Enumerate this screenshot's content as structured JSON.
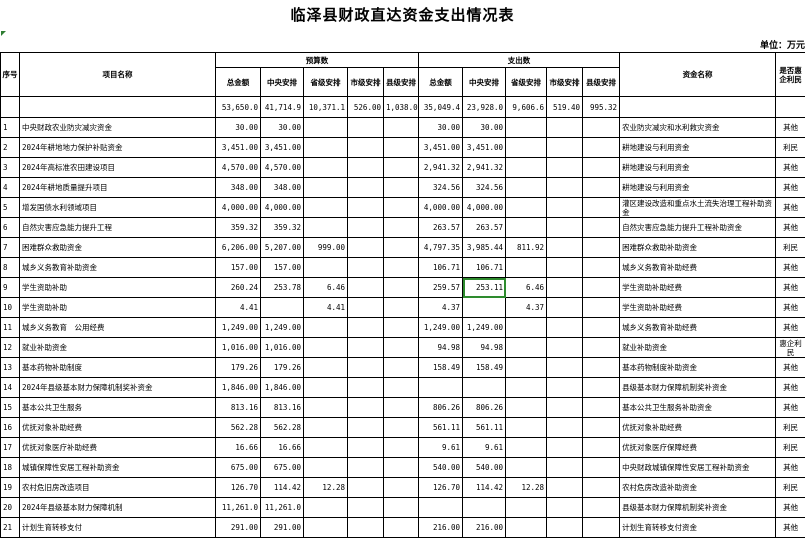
{
  "title": "临泽县财政直达资金支出情况表",
  "unit": "单位：万元",
  "headers": {
    "seq": "序号",
    "project": "项目名称",
    "budget_group": "预算数",
    "spend_group": "支出数",
    "fund_name": "资金名称",
    "benefit": "是否惠企利民",
    "budget_cols": [
      "总金额",
      "中央安排",
      "省级安排",
      "市级安排",
      "县级安排"
    ],
    "spend_cols": [
      "总金额",
      "中央安排",
      "省级安排",
      "市级安排",
      "县级安排"
    ]
  },
  "totals": {
    "budget": [
      "53,650.0",
      "41,714.9",
      "10,371.1",
      "526.00",
      "1,038.0"
    ],
    "spend": [
      "35,049.4",
      "23,928.0",
      "9,606.6",
      "519.40",
      "995.32"
    ]
  },
  "rows": [
    {
      "no": "1",
      "name": "中央财政农业防灾减灾资金",
      "b": [
        "30.00",
        "30.00",
        "",
        "",
        ""
      ],
      "s": [
        "30.00",
        "30.00",
        "",
        "",
        ""
      ],
      "fund": "农业防灾减灾和水利救灾资金",
      "flag": "其他"
    },
    {
      "no": "2",
      "name": "2024年耕地地力保护补贴资金",
      "b": [
        "3,451.00",
        "3,451.00",
        "",
        "",
        ""
      ],
      "s": [
        "3,451.00",
        "3,451.00",
        "",
        "",
        ""
      ],
      "fund": "耕地建设与利用资金",
      "flag": "利民"
    },
    {
      "no": "3",
      "name": "2024年高标准农田建设项目",
      "b": [
        "4,570.00",
        "4,570.00",
        "",
        "",
        ""
      ],
      "s": [
        "2,941.32",
        "2,941.32",
        "",
        "",
        ""
      ],
      "fund": "耕地建设与利用资金",
      "flag": "其他"
    },
    {
      "no": "4",
      "name": "2024年耕地质量提升项目",
      "b": [
        "348.00",
        "348.00",
        "",
        "",
        ""
      ],
      "s": [
        "324.56",
        "324.56",
        "",
        "",
        ""
      ],
      "fund": "耕地建设与利用资金",
      "flag": "其他"
    },
    {
      "no": "5",
      "name": "增发国债水利领域项目",
      "b": [
        "4,000.00",
        "4,000.00",
        "",
        "",
        ""
      ],
      "s": [
        "4,000.00",
        "4,000.00",
        "",
        "",
        ""
      ],
      "fund": "灌区建设改造和重点水土流失治理工程补助资金",
      "flag": "其他"
    },
    {
      "no": "6",
      "name": "自然灾害应急能力提升工程",
      "b": [
        "359.32",
        "359.32",
        "",
        "",
        ""
      ],
      "s": [
        "263.57",
        "263.57",
        "",
        "",
        ""
      ],
      "fund": "自然灾害应急能力提升工程补助资金",
      "flag": "其他"
    },
    {
      "no": "7",
      "name": "困难群众救助资金",
      "b": [
        "6,206.00",
        "5,207.00",
        "999.00",
        "",
        ""
      ],
      "s": [
        "4,797.35",
        "3,985.44",
        "811.92",
        "",
        ""
      ],
      "fund": "困难群众救助补助资金",
      "flag": "利民"
    },
    {
      "no": "8",
      "name": "城乡义务教育补助资金",
      "b": [
        "157.00",
        "157.00",
        "",
        "",
        ""
      ],
      "s": [
        "106.71",
        "106.71",
        "",
        "",
        ""
      ],
      "fund": "城乡义务教育补助经费",
      "flag": "其他"
    },
    {
      "no": "9",
      "name": "学生资助补助",
      "b": [
        "260.24",
        "253.78",
        "6.46",
        "",
        ""
      ],
      "s": [
        "259.57",
        "253.11",
        "6.46",
        "",
        ""
      ],
      "fund": "学生资助补助经费",
      "flag": "其他"
    },
    {
      "no": "10",
      "name": "学生资助补助",
      "b": [
        "4.41",
        "",
        "4.41",
        "",
        ""
      ],
      "s": [
        "4.37",
        "",
        "4.37",
        "",
        ""
      ],
      "fund": "学生资助补助经费",
      "flag": "其他"
    },
    {
      "no": "11",
      "name": "城乡义务教育　公用经费",
      "b": [
        "1,249.00",
        "1,249.00",
        "",
        "",
        ""
      ],
      "s": [
        "1,249.00",
        "1,249.00",
        "",
        "",
        ""
      ],
      "fund": "城乡义务教育补助经费",
      "flag": "其他"
    },
    {
      "no": "12",
      "name": "就业补助资金",
      "b": [
        "1,016.00",
        "1,016.00",
        "",
        "",
        ""
      ],
      "s": [
        "94.98",
        "94.98",
        "",
        "",
        ""
      ],
      "fund": "就业补助资金",
      "flag": "惠企利民"
    },
    {
      "no": "13",
      "name": "基本药物补助制度",
      "b": [
        "179.26",
        "179.26",
        "",
        "",
        ""
      ],
      "s": [
        "158.49",
        "158.49",
        "",
        "",
        ""
      ],
      "fund": "基本药物制度补助资金",
      "flag": "其他"
    },
    {
      "no": "14",
      "name": "2024年县级基本财力保障机制奖补资金",
      "b": [
        "1,846.00",
        "1,846.00",
        "",
        "",
        ""
      ],
      "s": [
        "",
        "",
        "",
        "",
        ""
      ],
      "fund": "县级基本财力保障机制奖补资金",
      "flag": "其他"
    },
    {
      "no": "15",
      "name": "基本公共卫生服务",
      "b": [
        "813.16",
        "813.16",
        "",
        "",
        ""
      ],
      "s": [
        "806.26",
        "806.26",
        "",
        "",
        ""
      ],
      "fund": "基本公共卫生服务补助资金",
      "flag": "其他"
    },
    {
      "no": "16",
      "name": "优抚对象补助经费",
      "b": [
        "562.28",
        "562.28",
        "",
        "",
        ""
      ],
      "s": [
        "561.11",
        "561.11",
        "",
        "",
        ""
      ],
      "fund": "优抚对象补助经费",
      "flag": "利民"
    },
    {
      "no": "17",
      "name": "优抚对象医疗补助经费",
      "b": [
        "16.66",
        "16.66",
        "",
        "",
        ""
      ],
      "s": [
        "9.61",
        "9.61",
        "",
        "",
        ""
      ],
      "fund": "优抚对象医疗保障经费",
      "flag": "利民"
    },
    {
      "no": "18",
      "name": "城镇保障性安居工程补助资金",
      "b": [
        "675.00",
        "675.00",
        "",
        "",
        ""
      ],
      "s": [
        "540.00",
        "540.00",
        "",
        "",
        ""
      ],
      "fund": "中央财政城镇保障性安居工程补助资金",
      "flag": "其他"
    },
    {
      "no": "19",
      "name": "农村危旧房改造项目",
      "b": [
        "126.70",
        "114.42",
        "12.28",
        "",
        ""
      ],
      "s": [
        "126.70",
        "114.42",
        "12.28",
        "",
        ""
      ],
      "fund": "农村危房改造补助资金",
      "flag": "利民"
    },
    {
      "no": "20",
      "name": "2024年县级基本财力保障机制",
      "b": [
        "11,261.0",
        "11,261.0",
        "",
        "",
        ""
      ],
      "s": [
        "",
        "",
        "",
        "",
        ""
      ],
      "fund": "县级基本财力保障机制奖补资金",
      "flag": "其他"
    },
    {
      "no": "21",
      "name": "计划生育转移支付",
      "b": [
        "291.00",
        "291.00",
        "",
        "",
        ""
      ],
      "s": [
        "216.00",
        "216.00",
        "",
        "",
        ""
      ],
      "fund": "计划生育转移支付资金",
      "flag": "其他"
    }
  ]
}
